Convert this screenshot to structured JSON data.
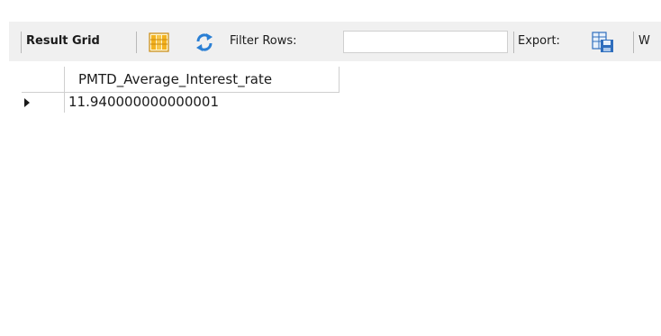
{
  "toolbar": {
    "result_grid_label": "Result Grid",
    "filter_label": "Filter Rows:",
    "filter_value": "",
    "export_label": "Export:",
    "truncated_label": "W"
  },
  "icons": {
    "grid_view": "grid-view-icon",
    "refresh": "refresh-icon",
    "export": "export-icon"
  },
  "colors": {
    "panel_background": "#f0f0f0",
    "grid_background": "#ffffff",
    "grid_icon": "#e8a317",
    "refresh_icon": "#2a7fd4"
  },
  "result_grid": {
    "columns": [
      "PMTD_Average_Interest_rate"
    ],
    "rows": [
      {
        "selected": true,
        "cells": [
          "11.940000000000001"
        ]
      }
    ]
  }
}
